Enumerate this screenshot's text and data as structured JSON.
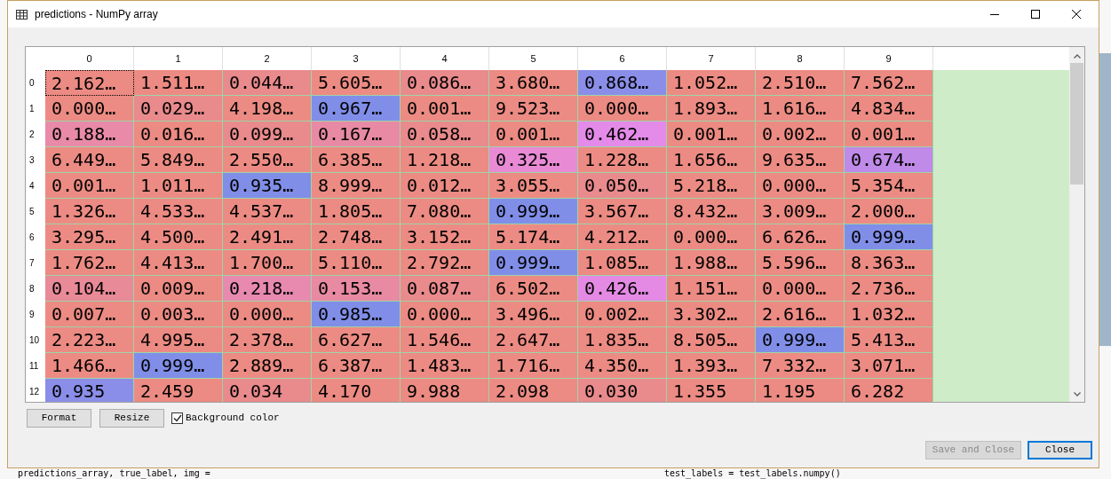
{
  "window": {
    "title": "predictions - NumPy array"
  },
  "table": {
    "columns": [
      "0",
      "1",
      "2",
      "3",
      "4",
      "5",
      "6",
      "7",
      "8",
      "9"
    ],
    "rows": [
      {
        "label": "0",
        "cells": [
          {
            "value": "2.162…",
            "color": "#ec8b83",
            "selected": true
          },
          {
            "value": "1.511…",
            "color": "#ec8b83",
            "selected": false
          },
          {
            "value": "0.044…",
            "color": "#e98a8c",
            "selected": false
          },
          {
            "value": "5.605…",
            "color": "#ec8b83",
            "selected": false
          },
          {
            "value": "0.086…",
            "color": "#e98a8c",
            "selected": false
          },
          {
            "value": "3.680…",
            "color": "#ec8b83",
            "selected": false
          },
          {
            "value": "0.868…",
            "color": "#8a8ee8",
            "selected": false
          },
          {
            "value": "1.052…",
            "color": "#ec8b83",
            "selected": false
          },
          {
            "value": "2.510…",
            "color": "#ec8b83",
            "selected": false
          },
          {
            "value": "7.562…",
            "color": "#ec8b83",
            "selected": false
          }
        ]
      },
      {
        "label": "1",
        "cells": [
          {
            "value": "0.000…",
            "color": "#ec8b83",
            "selected": false
          },
          {
            "value": "0.029…",
            "color": "#e98a8c",
            "selected": false
          },
          {
            "value": "4.198…",
            "color": "#ec8b83",
            "selected": false
          },
          {
            "value": "0.967…",
            "color": "#808ee8",
            "selected": false
          },
          {
            "value": "0.001…",
            "color": "#ec8b83",
            "selected": false
          },
          {
            "value": "9.523…",
            "color": "#ec8b83",
            "selected": false
          },
          {
            "value": "0.000…",
            "color": "#ec8b83",
            "selected": false
          },
          {
            "value": "1.893…",
            "color": "#ec8b83",
            "selected": false
          },
          {
            "value": "1.616…",
            "color": "#ec8b83",
            "selected": false
          },
          {
            "value": "4.834…",
            "color": "#ec8b83",
            "selected": false
          }
        ]
      },
      {
        "label": "2",
        "cells": [
          {
            "value": "0.188…",
            "color": "#e88aa8",
            "selected": false
          },
          {
            "value": "0.016…",
            "color": "#ec8b83",
            "selected": false
          },
          {
            "value": "0.099…",
            "color": "#e98a8c",
            "selected": false
          },
          {
            "value": "0.167…",
            "color": "#e88aa4",
            "selected": false
          },
          {
            "value": "0.058…",
            "color": "#e98a8c",
            "selected": false
          },
          {
            "value": "0.001…",
            "color": "#ec8b83",
            "selected": false
          },
          {
            "value": "0.462…",
            "color": "#e48ae8",
            "selected": false
          },
          {
            "value": "0.001…",
            "color": "#ec8b83",
            "selected": false
          },
          {
            "value": "0.002…",
            "color": "#ec8b83",
            "selected": false
          },
          {
            "value": "0.001…",
            "color": "#ec8b83",
            "selected": false
          }
        ]
      },
      {
        "label": "3",
        "cells": [
          {
            "value": "6.449…",
            "color": "#ec8b83",
            "selected": false
          },
          {
            "value": "5.849…",
            "color": "#ec8b83",
            "selected": false
          },
          {
            "value": "2.550…",
            "color": "#ec8b83",
            "selected": false
          },
          {
            "value": "6.385…",
            "color": "#ec8b83",
            "selected": false
          },
          {
            "value": "1.218…",
            "color": "#ec8b83",
            "selected": false
          },
          {
            "value": "0.325…",
            "color": "#e88ad4",
            "selected": false
          },
          {
            "value": "1.228…",
            "color": "#ec8b83",
            "selected": false
          },
          {
            "value": "1.656…",
            "color": "#ec8b83",
            "selected": false
          },
          {
            "value": "9.635…",
            "color": "#ec8b83",
            "selected": false
          },
          {
            "value": "0.674…",
            "color": "#c08ae8",
            "selected": false
          }
        ]
      },
      {
        "label": "4",
        "cells": [
          {
            "value": "0.001…",
            "color": "#ec8b83",
            "selected": false
          },
          {
            "value": "1.011…",
            "color": "#ec8b83",
            "selected": false
          },
          {
            "value": "0.935…",
            "color": "#808ee8",
            "selected": false
          },
          {
            "value": "8.999…",
            "color": "#ec8b83",
            "selected": false
          },
          {
            "value": "0.012…",
            "color": "#ec8b83",
            "selected": false
          },
          {
            "value": "3.055…",
            "color": "#ec8b83",
            "selected": false
          },
          {
            "value": "0.050…",
            "color": "#e98a8c",
            "selected": false
          },
          {
            "value": "5.218…",
            "color": "#ec8b83",
            "selected": false
          },
          {
            "value": "0.000…",
            "color": "#ec8b83",
            "selected": false
          },
          {
            "value": "5.354…",
            "color": "#ec8b83",
            "selected": false
          }
        ]
      },
      {
        "label": "5",
        "cells": [
          {
            "value": "1.326…",
            "color": "#ec8b83",
            "selected": false
          },
          {
            "value": "4.533…",
            "color": "#ec8b83",
            "selected": false
          },
          {
            "value": "4.537…",
            "color": "#ec8b83",
            "selected": false
          },
          {
            "value": "1.805…",
            "color": "#ec8b83",
            "selected": false
          },
          {
            "value": "7.080…",
            "color": "#ec8b83",
            "selected": false
          },
          {
            "value": "0.999…",
            "color": "#808ee8",
            "selected": false
          },
          {
            "value": "3.567…",
            "color": "#ec8b83",
            "selected": false
          },
          {
            "value": "8.432…",
            "color": "#ec8b83",
            "selected": false
          },
          {
            "value": "3.009…",
            "color": "#ec8b83",
            "selected": false
          },
          {
            "value": "2.000…",
            "color": "#ec8b83",
            "selected": false
          }
        ]
      },
      {
        "label": "6",
        "cells": [
          {
            "value": "3.295…",
            "color": "#ec8b83",
            "selected": false
          },
          {
            "value": "4.500…",
            "color": "#ec8b83",
            "selected": false
          },
          {
            "value": "2.491…",
            "color": "#ec8b83",
            "selected": false
          },
          {
            "value": "2.748…",
            "color": "#ec8b83",
            "selected": false
          },
          {
            "value": "3.152…",
            "color": "#ec8b83",
            "selected": false
          },
          {
            "value": "5.174…",
            "color": "#ec8b83",
            "selected": false
          },
          {
            "value": "4.212…",
            "color": "#ec8b83",
            "selected": false
          },
          {
            "value": "0.000…",
            "color": "#ec8b83",
            "selected": false
          },
          {
            "value": "6.626…",
            "color": "#ec8b83",
            "selected": false
          },
          {
            "value": "0.999…",
            "color": "#808ee8",
            "selected": false
          }
        ]
      },
      {
        "label": "7",
        "cells": [
          {
            "value": "1.762…",
            "color": "#ec8b83",
            "selected": false
          },
          {
            "value": "4.413…",
            "color": "#ec8b83",
            "selected": false
          },
          {
            "value": "1.700…",
            "color": "#ec8b83",
            "selected": false
          },
          {
            "value": "5.110…",
            "color": "#ec8b83",
            "selected": false
          },
          {
            "value": "2.792…",
            "color": "#ec8b83",
            "selected": false
          },
          {
            "value": "0.999…",
            "color": "#808ee8",
            "selected": false
          },
          {
            "value": "1.085…",
            "color": "#ec8b83",
            "selected": false
          },
          {
            "value": "1.988…",
            "color": "#ec8b83",
            "selected": false
          },
          {
            "value": "5.596…",
            "color": "#ec8b83",
            "selected": false
          },
          {
            "value": "8.363…",
            "color": "#ec8b83",
            "selected": false
          }
        ]
      },
      {
        "label": "8",
        "cells": [
          {
            "value": "0.104…",
            "color": "#e98a98",
            "selected": false
          },
          {
            "value": "0.009…",
            "color": "#ec8b83",
            "selected": false
          },
          {
            "value": "0.218…",
            "color": "#e88ab0",
            "selected": false
          },
          {
            "value": "0.153…",
            "color": "#e88aa2",
            "selected": false
          },
          {
            "value": "0.087…",
            "color": "#e98a8c",
            "selected": false
          },
          {
            "value": "6.502…",
            "color": "#ec8b83",
            "selected": false
          },
          {
            "value": "0.426…",
            "color": "#e48ae4",
            "selected": false
          },
          {
            "value": "1.151…",
            "color": "#ec8b83",
            "selected": false
          },
          {
            "value": "0.000…",
            "color": "#ec8b83",
            "selected": false
          },
          {
            "value": "2.736…",
            "color": "#ec8b83",
            "selected": false
          }
        ]
      },
      {
        "label": "9",
        "cells": [
          {
            "value": "0.007…",
            "color": "#ec8b83",
            "selected": false
          },
          {
            "value": "0.003…",
            "color": "#ec8b83",
            "selected": false
          },
          {
            "value": "0.000…",
            "color": "#ec8b83",
            "selected": false
          },
          {
            "value": "0.985…",
            "color": "#808ee8",
            "selected": false
          },
          {
            "value": "0.000…",
            "color": "#ec8b83",
            "selected": false
          },
          {
            "value": "3.496…",
            "color": "#ec8b83",
            "selected": false
          },
          {
            "value": "0.002…",
            "color": "#ec8b83",
            "selected": false
          },
          {
            "value": "3.302…",
            "color": "#ec8b83",
            "selected": false
          },
          {
            "value": "2.616…",
            "color": "#ec8b83",
            "selected": false
          },
          {
            "value": "1.032…",
            "color": "#ec8b83",
            "selected": false
          }
        ]
      },
      {
        "label": "10",
        "cells": [
          {
            "value": "2.223…",
            "color": "#ec8b83",
            "selected": false
          },
          {
            "value": "4.995…",
            "color": "#ec8b83",
            "selected": false
          },
          {
            "value": "2.378…",
            "color": "#ec8b83",
            "selected": false
          },
          {
            "value": "6.627…",
            "color": "#ec8b83",
            "selected": false
          },
          {
            "value": "1.546…",
            "color": "#ec8b83",
            "selected": false
          },
          {
            "value": "2.647…",
            "color": "#ec8b83",
            "selected": false
          },
          {
            "value": "1.835…",
            "color": "#ec8b83",
            "selected": false
          },
          {
            "value": "8.505…",
            "color": "#ec8b83",
            "selected": false
          },
          {
            "value": "0.999…",
            "color": "#808ee8",
            "selected": false
          },
          {
            "value": "5.413…",
            "color": "#ec8b83",
            "selected": false
          }
        ]
      },
      {
        "label": "11",
        "cells": [
          {
            "value": "1.466…",
            "color": "#ec8b83",
            "selected": false
          },
          {
            "value": "0.999…",
            "color": "#808ee8",
            "selected": false
          },
          {
            "value": "2.889…",
            "color": "#ec8b83",
            "selected": false
          },
          {
            "value": "6.387…",
            "color": "#ec8b83",
            "selected": false
          },
          {
            "value": "1.483…",
            "color": "#ec8b83",
            "selected": false
          },
          {
            "value": "1.716…",
            "color": "#ec8b83",
            "selected": false
          },
          {
            "value": "4.350…",
            "color": "#ec8b83",
            "selected": false
          },
          {
            "value": "1.393…",
            "color": "#ec8b83",
            "selected": false
          },
          {
            "value": "7.332…",
            "color": "#ec8b83",
            "selected": false
          },
          {
            "value": "3.071…",
            "color": "#ec8b83",
            "selected": false
          }
        ]
      },
      {
        "label": "12",
        "cells": [
          {
            "value": "0.935",
            "color": "#8a8ee8",
            "selected": false
          },
          {
            "value": "2.459",
            "color": "#ec8b83",
            "selected": false
          },
          {
            "value": "0.034",
            "color": "#e98a8c",
            "selected": false
          },
          {
            "value": "4.170",
            "color": "#ec8b83",
            "selected": false
          },
          {
            "value": "9.988",
            "color": "#ec8b83",
            "selected": false
          },
          {
            "value": "2.098",
            "color": "#ec8b83",
            "selected": false
          },
          {
            "value": "0.030",
            "color": "#e98a8c",
            "selected": false
          },
          {
            "value": "1.355",
            "color": "#ec8b83",
            "selected": false
          },
          {
            "value": "1.195",
            "color": "#ec8b83",
            "selected": false
          },
          {
            "value": "6.282",
            "color": "#ec8b83",
            "selected": false
          }
        ]
      }
    ]
  },
  "buttons_left": [
    "Format",
    "Resize"
  ],
  "background_color": {
    "label": "Background color",
    "checked": true
  },
  "buttons_right": [
    {
      "label": "Save and Close",
      "disabled": true,
      "default": false
    },
    {
      "label": "Close",
      "disabled": false,
      "default": true
    }
  ],
  "editor_lines": [
    "predictions_array, true_label, img =",
    "test_labels = test_labels.numpy()"
  ]
}
